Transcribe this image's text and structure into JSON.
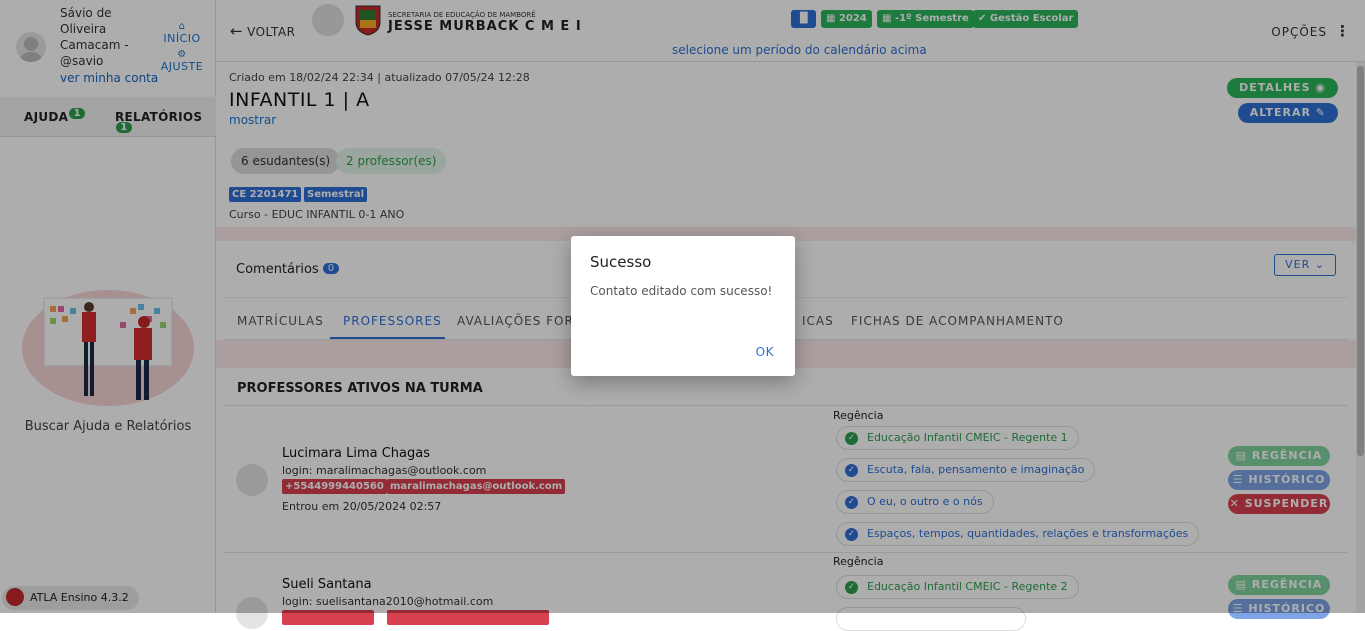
{
  "sidebar": {
    "user_name": "Sávio de Oliveira Camacam - @savio",
    "account_link": "ver minha conta",
    "home_label": "INÍCIO",
    "settings_label": "AJUSTE",
    "tabs": [
      {
        "label": "AJUDA",
        "badge": "1"
      },
      {
        "label": "RELATÓRIOS",
        "badge": "1"
      }
    ],
    "help_text": "Buscar Ajuda e Relatórios",
    "version": "ATLA Ensino 4.3.2"
  },
  "header": {
    "back_label": "VOLTAR",
    "school_subtitle": "SECRETARIA DE EDUCAÇÃO DE MAMBORÊ",
    "school_name": "JESSE MURBACK C M E I",
    "chips": [
      "2024",
      "-1º Semestre",
      "Gestão Escolar"
    ],
    "period_hint": "selecione um período do calendário acima",
    "options_label": "OPÇÕES"
  },
  "class_info": {
    "meta": "Criado em 18/02/24 22:34 | atualizado 07/05/24 12:28",
    "title": "INFANTIL 1 | A",
    "show_link": "mostrar",
    "details_button": "DETALHES",
    "edit_button": "ALTERAR",
    "students_pill": "6 esudantes(s)",
    "teachers_pill": "2 professor(es)",
    "tags": [
      "CE 2201471",
      "Semestral"
    ],
    "course": "Curso - EDUC INFANTIL 0-1 ANO"
  },
  "comments": {
    "label": "Comentários",
    "count": "0",
    "view_button": "VER"
  },
  "tabs": [
    "MATRÍCULAS",
    "PROFESSORES",
    "AVALIAÇÕES FORM",
    "ICAS",
    "FICHAS DE ACOMPANHAMENTO"
  ],
  "section_title": "PROFESSORES ATIVOS NA TURMA",
  "professors": [
    {
      "name": "Lucimara Lima Chagas",
      "login": "login: maralimachagas@outlook.com",
      "phone": "+5544999440560",
      "email": "maralimachagas@outlook.com",
      "entry": "Entrou em 20/05/2024 02:57",
      "regencia_label": "Regência",
      "regencias": [
        "Educação Infantil CMEIC - Regente 1",
        "Escuta, fala, pensamento e imaginação",
        "O eu, o outro e o nós",
        "Espaços, tempos, quantidades, relações e transformações"
      ],
      "actions": [
        "REGÊNCIA",
        "HISTÓRICO",
        "SUSPENDER"
      ]
    },
    {
      "name": "Sueli Santana",
      "login": "login: suelisantana2010@hotmail.com",
      "regencia_label": "Regência",
      "regencias": [
        "Educação Infantil CMEIC - Regente 2"
      ],
      "actions": [
        "REGÊNCIA",
        "HISTÓRICO"
      ]
    }
  ],
  "dialog": {
    "title": "Sucesso",
    "message": "Contato editado com sucesso!",
    "ok_button": "OK"
  }
}
